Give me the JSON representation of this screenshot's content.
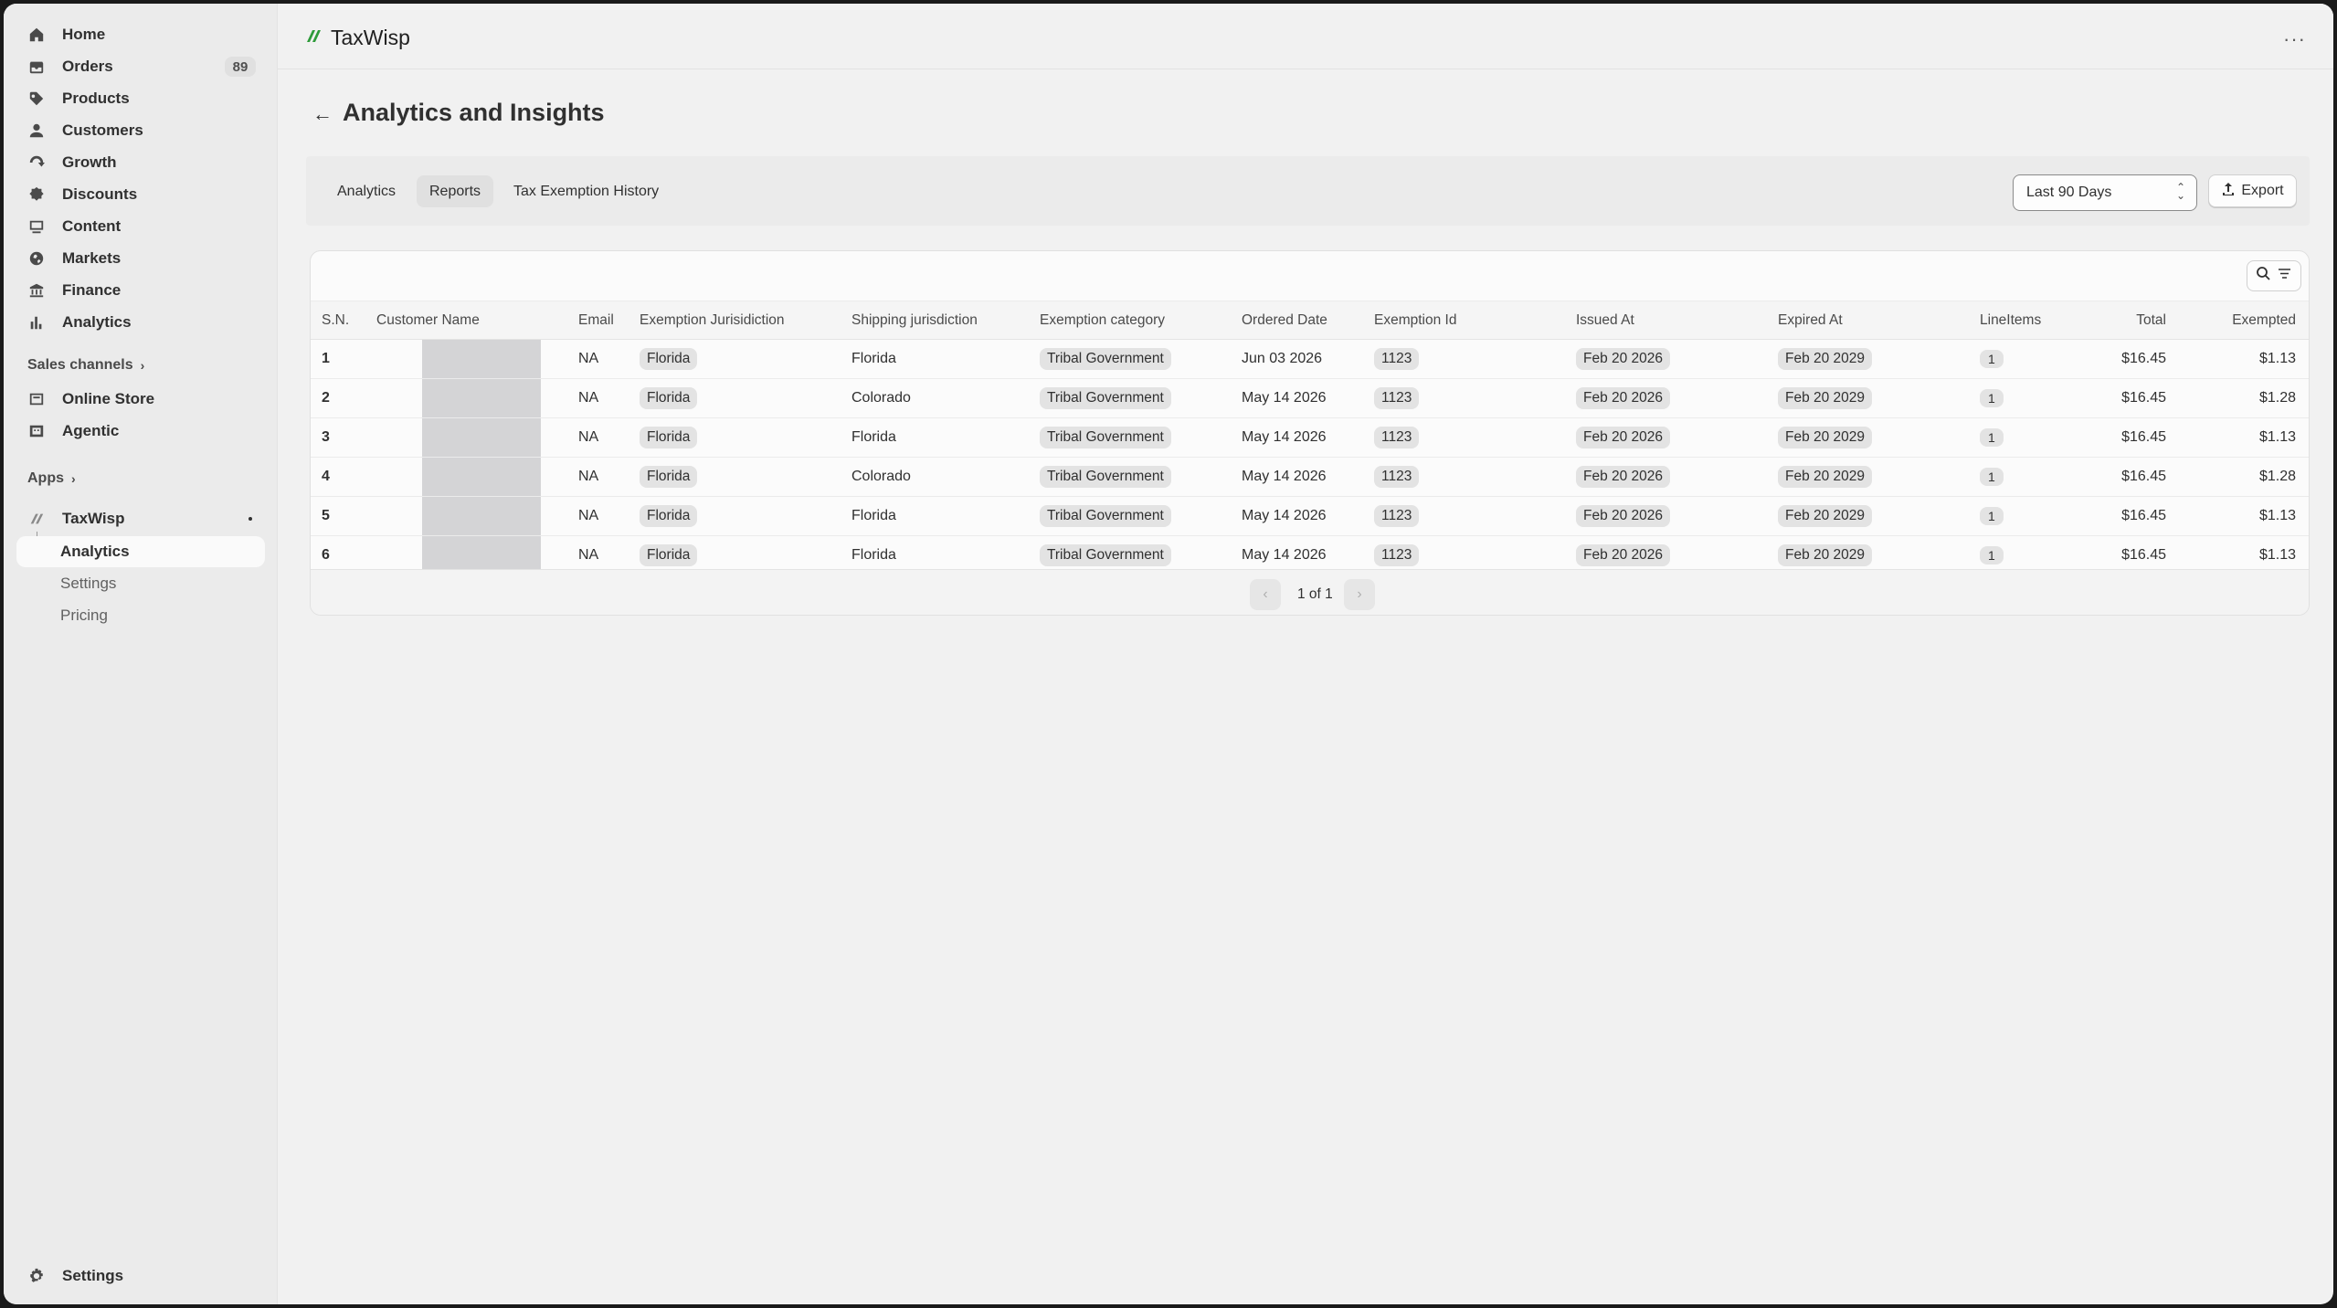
{
  "sidebar": {
    "items": [
      {
        "label": "Home",
        "icon": "home-icon"
      },
      {
        "label": "Orders",
        "icon": "orders-icon",
        "badge": "89"
      },
      {
        "label": "Products",
        "icon": "tag-icon"
      },
      {
        "label": "Customers",
        "icon": "person-icon"
      },
      {
        "label": "Growth",
        "icon": "growth-icon"
      },
      {
        "label": "Discounts",
        "icon": "discount-icon"
      },
      {
        "label": "Content",
        "icon": "content-icon"
      },
      {
        "label": "Markets",
        "icon": "globe-icon"
      },
      {
        "label": "Finance",
        "icon": "bank-icon"
      },
      {
        "label": "Analytics",
        "icon": "bar-chart-icon"
      }
    ],
    "sales_channels_label": "Sales channels",
    "channels": [
      {
        "label": "Online Store",
        "icon": "store-icon"
      },
      {
        "label": "Agentic",
        "icon": "agentic-icon"
      }
    ],
    "apps_label": "Apps",
    "app": {
      "label": "TaxWisp",
      "icon": "taxwisp-leaf-icon"
    },
    "app_sub": [
      "Analytics",
      "Settings",
      "Pricing"
    ],
    "settings_label": "Settings"
  },
  "topbar": {
    "brand": "TaxWisp",
    "more": "···"
  },
  "page": {
    "title": "Analytics and Insights"
  },
  "tabs": [
    "Analytics",
    "Reports",
    "Tax Exemption History"
  ],
  "active_tab": "Reports",
  "date_range": {
    "value": "Last 90 Days"
  },
  "export_label": "Export",
  "table": {
    "headers": [
      "S.N.",
      "Customer Name",
      "Email",
      "Exemption Jurisidiction",
      "Shipping jurisdiction",
      "Exemption category",
      "Ordered Date",
      "Exemption Id",
      "Issued At",
      "Expired At",
      "LineItems",
      "Total",
      "Exempted"
    ],
    "rows": [
      {
        "sn": "1",
        "email": "NA",
        "exemption_jurisdiction": "Florida",
        "shipping_jurisdiction": "Florida",
        "category": "Tribal Government",
        "ordered": "Jun 03 2026",
        "exemption_id": "1123",
        "issued": "Feb 20 2026",
        "expired": "Feb 20 2029",
        "line_items": "1",
        "total": "$16.45",
        "exempted": "$1.13"
      },
      {
        "sn": "2",
        "email": "NA",
        "exemption_jurisdiction": "Florida",
        "shipping_jurisdiction": "Colorado",
        "category": "Tribal Government",
        "ordered": "May 14 2026",
        "exemption_id": "1123",
        "issued": "Feb 20 2026",
        "expired": "Feb 20 2029",
        "line_items": "1",
        "total": "$16.45",
        "exempted": "$1.28"
      },
      {
        "sn": "3",
        "email": "NA",
        "exemption_jurisdiction": "Florida",
        "shipping_jurisdiction": "Florida",
        "category": "Tribal Government",
        "ordered": "May 14 2026",
        "exemption_id": "1123",
        "issued": "Feb 20 2026",
        "expired": "Feb 20 2029",
        "line_items": "1",
        "total": "$16.45",
        "exempted": "$1.13"
      },
      {
        "sn": "4",
        "email": "NA",
        "exemption_jurisdiction": "Florida",
        "shipping_jurisdiction": "Colorado",
        "category": "Tribal Government",
        "ordered": "May 14 2026",
        "exemption_id": "1123",
        "issued": "Feb 20 2026",
        "expired": "Feb 20 2029",
        "line_items": "1",
        "total": "$16.45",
        "exempted": "$1.28"
      },
      {
        "sn": "5",
        "email": "NA",
        "exemption_jurisdiction": "Florida",
        "shipping_jurisdiction": "Florida",
        "category": "Tribal Government",
        "ordered": "May 14 2026",
        "exemption_id": "1123",
        "issued": "Feb 20 2026",
        "expired": "Feb 20 2029",
        "line_items": "1",
        "total": "$16.45",
        "exempted": "$1.13"
      },
      {
        "sn": "6",
        "email": "NA",
        "exemption_jurisdiction": "Florida",
        "shipping_jurisdiction": "Florida",
        "category": "Tribal Government",
        "ordered": "May 14 2026",
        "exemption_id": "1123",
        "issued": "Feb 20 2026",
        "expired": "Feb 20 2029",
        "line_items": "1",
        "total": "$16.45",
        "exempted": "$1.13"
      }
    ]
  },
  "pagination": {
    "text": "1 of 1"
  },
  "colors": {
    "brand_green": "#2e9b3a",
    "background": "#f1f1f1",
    "sidebar": "#ebebeb"
  }
}
